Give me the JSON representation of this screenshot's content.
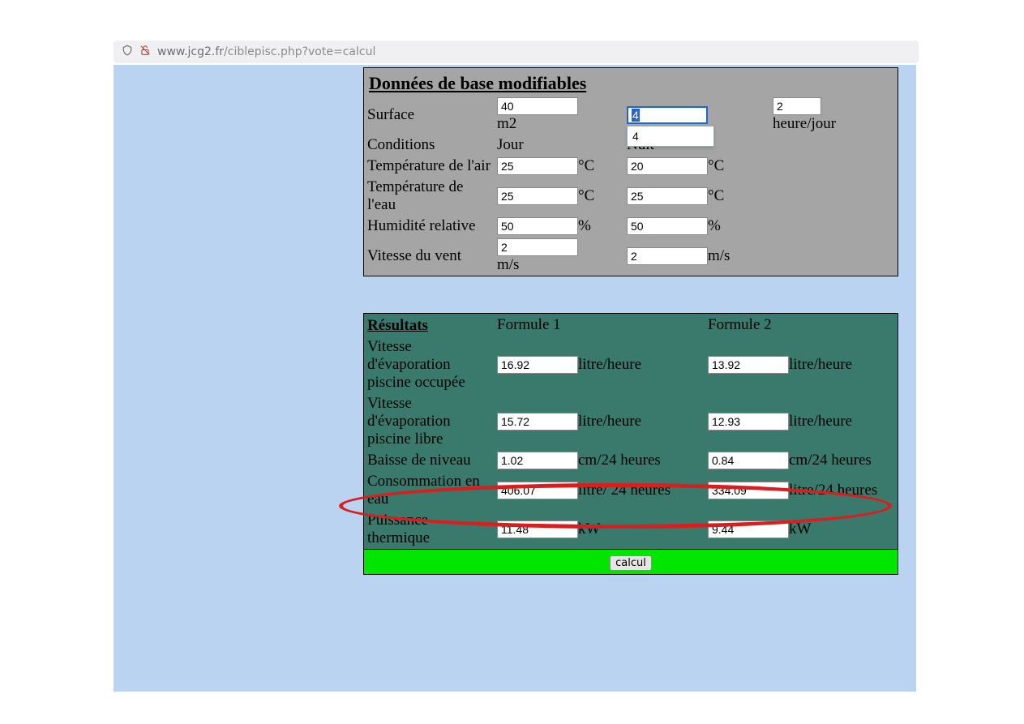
{
  "address": {
    "host": "www.jcg2.fr",
    "path": "/ciblepisc.php?vote=calcul"
  },
  "inputs": {
    "title": "Données de base modifiables",
    "surface_label": "Surface",
    "surface_value": "40",
    "surface_unit": "m2",
    "col2_sel_value": "4",
    "col2_drop_value": "4",
    "col3_value": "2",
    "col3_unit": "heure/jour",
    "conditions_label": "Conditions",
    "cond_day": "Jour",
    "cond_night": "Nuit",
    "tair_label": "Température de l'air",
    "tair_day": "25",
    "tair_night": "20",
    "tair_unit": "°C",
    "teau_label": "Température de l'eau",
    "teau_day": "25",
    "teau_night": "25",
    "teau_unit": "°C",
    "hum_label": "Humidité relative",
    "hum_day": "50",
    "hum_night": "50",
    "hum_unit": "%",
    "vent_label": "Vitesse du vent",
    "vent_day": "2",
    "vent_night": "2",
    "vent_unit": "m/s"
  },
  "results": {
    "title": "Résultats",
    "col1_label": "Formule 1",
    "col2_label": "Formule 2",
    "unit_lh": "litre/heure",
    "unit_cm24": "cm/24 heures",
    "unit_l24a": "litre/ 24 heures",
    "unit_l24b": "litre/24 heures",
    "unit_kw": "kW",
    "evap_occ_label": "Vitesse d'évaporation piscine occupée",
    "evap_occ_f1": "16.92",
    "evap_occ_f2": "13.92",
    "evap_lib_label": "Vitesse d'évaporation piscine libre",
    "evap_lib_f1": "15.72",
    "evap_lib_f2": "12.93",
    "baisse_label": "Baisse de niveau",
    "baisse_f1": "1.02",
    "baisse_f2": "0.84",
    "conso_label": "Consommation en eau",
    "conso_f1": "406.07",
    "conso_f2": "334.09",
    "pth_label": "Puissance thermique",
    "pth_f1": "11.48",
    "pth_f2": "9.44"
  },
  "calc_label": "calcul"
}
